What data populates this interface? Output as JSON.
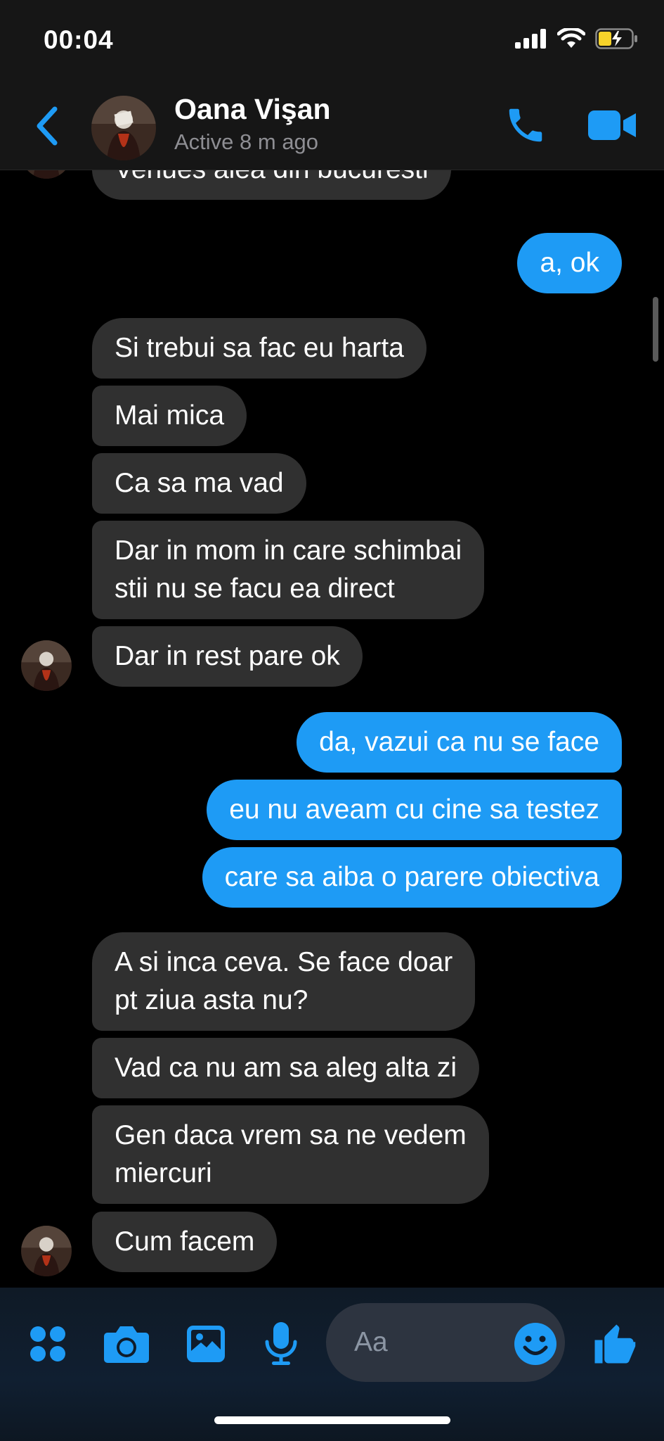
{
  "status_bar": {
    "time": "00:04"
  },
  "header": {
    "contact_name": "Oana Vişan",
    "status": "Active 8 m ago"
  },
  "messages": [
    {
      "side": "in",
      "text": "Venues alea din bucuresti"
    },
    {
      "side": "out",
      "text": "a, ok"
    },
    {
      "side": "in",
      "text": "Si trebui sa fac eu harta"
    },
    {
      "side": "in",
      "text": "Mai mica"
    },
    {
      "side": "in",
      "text": "Ca sa ma vad"
    },
    {
      "side": "in",
      "lines": [
        "Dar in mom in care schimbai",
        "stii nu se facu ea direct"
      ]
    },
    {
      "side": "in",
      "text": "Dar in rest pare ok"
    },
    {
      "side": "out",
      "text": "da, vazui ca nu se face"
    },
    {
      "side": "out",
      "text": "eu nu aveam cu cine sa testez"
    },
    {
      "side": "out",
      "text": "care sa aiba o parere obiectiva"
    },
    {
      "side": "in",
      "lines": [
        "A si inca ceva. Se face doar",
        "pt ziua asta nu?"
      ]
    },
    {
      "side": "in",
      "text": "Vad ca nu am sa aleg alta zi"
    },
    {
      "side": "in",
      "lines": [
        "Gen daca vrem sa ne vedem",
        "miercuri"
      ]
    },
    {
      "side": "in",
      "text": "Cum facem"
    }
  ],
  "composer": {
    "placeholder": "Aa"
  },
  "colors": {
    "accent": "#1e9bf5",
    "incoming_bubble": "#303030",
    "header_bg": "#161616",
    "battery": "#f7d32a"
  },
  "icons": {
    "back": "chevron-left-icon",
    "call": "phone-icon",
    "video": "video-camera-icon",
    "apps": "four-dots-icon",
    "camera": "camera-icon",
    "gallery": "image-icon",
    "voice": "microphone-icon",
    "emoji": "smiley-icon",
    "like": "thumbs-up-icon"
  }
}
